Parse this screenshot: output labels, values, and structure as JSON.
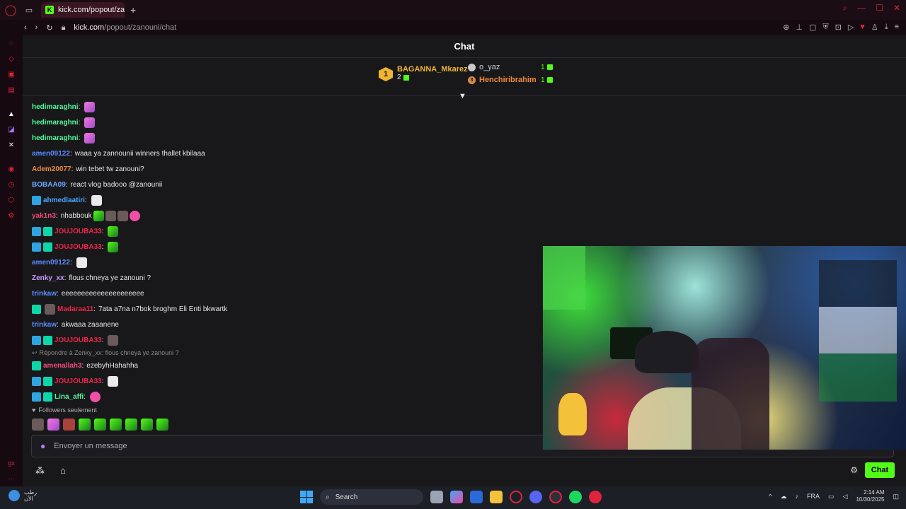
{
  "browser": {
    "tab_title": "kick.com/popout/zanouni",
    "url_host": "kick.com",
    "url_path": "/popout/zanouni/chat"
  },
  "chat": {
    "header_title": "Chat",
    "leaderboard": {
      "first": {
        "rank": "1",
        "name": "BAGANNA_Mkarez",
        "count": "2"
      },
      "second": {
        "name": "o_yaz",
        "count": "1"
      },
      "third": {
        "rank": "3",
        "name": "Henchiribrahim",
        "count": "1"
      }
    },
    "messages": [
      {
        "user": "hedimaraghni",
        "color": "#53fc9a",
        "text": "",
        "badges": [],
        "emotes": [
          "pink"
        ]
      },
      {
        "user": "hedimaraghni",
        "color": "#53fc9a",
        "text": "",
        "badges": [],
        "emotes": [
          "pink"
        ]
      },
      {
        "user": "hedimaraghni",
        "color": "#53fc9a",
        "text": "",
        "badges": [],
        "emotes": [
          "pink"
        ]
      },
      {
        "user": "amen09122",
        "color": "#5b8cff",
        "text": "waaa ya zannounii winners thallet kbilaaa",
        "badges": [],
        "emotes": []
      },
      {
        "user": "Adem20077",
        "color": "#f08a3c",
        "text": "win tebet tw zanouni?",
        "badges": [],
        "emotes": []
      },
      {
        "user": "BOBAA09",
        "color": "#6aa9ff",
        "text": "react vlog badooo @zanounii",
        "badges": [],
        "emotes": []
      },
      {
        "user": "ahmedlaatiri",
        "color": "#4aa8ff",
        "text": "",
        "badges": [
          "founder"
        ],
        "emotes": [
          "white"
        ]
      },
      {
        "user": "yak1n3",
        "color": "#f04a7a",
        "text": "nhabbouk",
        "badges": [],
        "emotes": [
          "green",
          "dark",
          "dark",
          "heart"
        ]
      },
      {
        "user": "JOUJOUBA33",
        "color": "#f0244a",
        "text": "",
        "badges": [
          "founder",
          "sub"
        ],
        "emotes": [
          "green"
        ]
      },
      {
        "user": "JOUJOUBA33",
        "color": "#f0244a",
        "text": "",
        "badges": [
          "founder",
          "sub"
        ],
        "emotes": [
          "green"
        ]
      },
      {
        "user": "amen09122",
        "color": "#5b8cff",
        "text": "",
        "badges": [],
        "emotes": [
          "white"
        ]
      },
      {
        "user": "Zenky_xx",
        "color": "#c79bff",
        "text": "flous chneya ye zanouni ?",
        "badges": [],
        "emotes": []
      },
      {
        "user": "trinkaw",
        "color": "#5b8cff",
        "text": "eeeeeeeeeeeeeeeeeeeee",
        "badges": [],
        "emotes": []
      },
      {
        "user": "Madaraa11",
        "color": "#f0244a",
        "text": "7ata a7na n7bok broghm Eli Enti bkwartk",
        "badges": [
          "sub",
          "dark"
        ],
        "emotes": []
      },
      {
        "user": "trinkaw",
        "color": "#5b8cff",
        "text": "akwaaa zaaanene",
        "badges": [],
        "emotes": []
      },
      {
        "user": "JOUJOUBA33",
        "color": "#f0244a",
        "text": "",
        "badges": [
          "founder",
          "sub"
        ],
        "emotes": [
          "dark"
        ]
      }
    ],
    "reply": "Répondre à Zenky_xx: flous chneya ye zanouni ?",
    "messages2": [
      {
        "user": "amenallah3",
        "color": "#f04a7a",
        "text": "ezebyhHahahha",
        "badges": [
          "sub"
        ],
        "emotes": []
      },
      {
        "user": "JOUJOUBA33",
        "color": "#f0244a",
        "text": "",
        "badges": [
          "founder",
          "sub"
        ],
        "emotes": [
          "white"
        ]
      },
      {
        "user": "Lina_affi",
        "color": "#53fc9a",
        "text": "",
        "badges": [
          "founder",
          "sub"
        ],
        "emotes": [
          "heart"
        ]
      }
    ],
    "followers_only": "Followers seulement",
    "input_placeholder": "Envoyer un message",
    "send_label": "Chat"
  },
  "taskbar": {
    "weather_line1": "رطب",
    "weather_line2": "الآن",
    "search_label": "Search",
    "language": "FRA",
    "time": "2:14 AM",
    "date": "10/30/2025"
  },
  "colors": {
    "accent": "#53fc18",
    "opera_red": "#e0233f",
    "panel_bg": "#18181b"
  }
}
